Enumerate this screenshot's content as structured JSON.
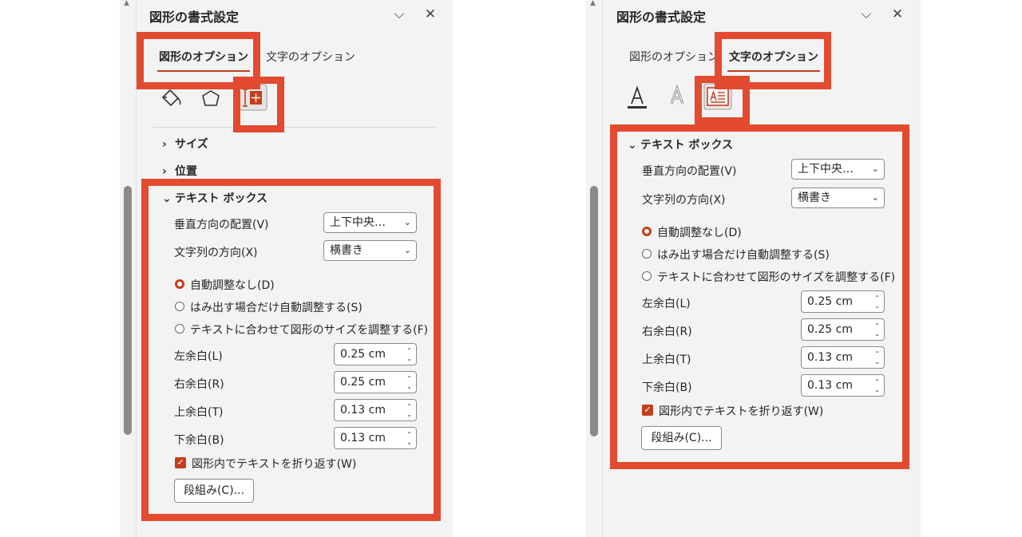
{
  "left_panel": {
    "title": "図形の書式設定",
    "tabs": [
      "図形のオプション",
      "文字のオプション"
    ],
    "sections": [
      "サイズ",
      "位置",
      "テキスト ボックス"
    ],
    "vertical_align": {
      "label": "垂直方向の配置(V)",
      "value": "上下中央…"
    },
    "text_direction": {
      "label": "文字列の方向(X)",
      "value": "横書き"
    },
    "autofit": [
      "自動調整なし(D)",
      "はみ出す場合だけ自動調整する(S)",
      "テキストに合わせて図形のサイズを調整する(F)"
    ],
    "margins": [
      {
        "label": "左余白(L)",
        "value": "0.25 cm"
      },
      {
        "label": "右余白(R)",
        "value": "0.25 cm"
      },
      {
        "label": "上余白(T)",
        "value": "0.13 cm"
      },
      {
        "label": "下余白(B)",
        "value": "0.13 cm"
      }
    ],
    "wrap_text": "図形内でテキストを折り返す(W)",
    "columns_button": "段組み(C)..."
  },
  "right_panel": {
    "title": "図形の書式設定",
    "tabs": [
      "図形のオプション",
      "文字のオプション"
    ],
    "sections": [
      "テキスト ボックス"
    ],
    "vertical_align": {
      "label": "垂直方向の配置(V)",
      "value": "上下中央…"
    },
    "text_direction": {
      "label": "文字列の方向(X)",
      "value": "横書き"
    },
    "autofit": [
      "自動調整なし(D)",
      "はみ出す場合だけ自動調整する(S)",
      "テキストに合わせて図形のサイズを調整する(F)"
    ],
    "margins": [
      {
        "label": "左余白(L)",
        "value": "0.25 cm"
      },
      {
        "label": "右余白(R)",
        "value": "0.25 cm"
      },
      {
        "label": "上余白(T)",
        "value": "0.13 cm"
      },
      {
        "label": "下余白(B)",
        "value": "0.13 cm"
      }
    ],
    "wrap_text": "図形内でテキストを折り返す(W)",
    "columns_button": "段組み(C)..."
  },
  "icons": {
    "collapse": "chevron-down-icon",
    "close": "close-icon",
    "fill_line": "paint-bucket-icon",
    "effects": "pentagon-icon",
    "size_properties": "layout-properties-icon",
    "text_fill": "text-fill-icon",
    "text_effects": "text-outline-icon",
    "textbox": "textbox-icon"
  },
  "colors": {
    "accent": "#c43e1c",
    "highlight": "#e24b2f",
    "panel": "#f3f3f3"
  }
}
